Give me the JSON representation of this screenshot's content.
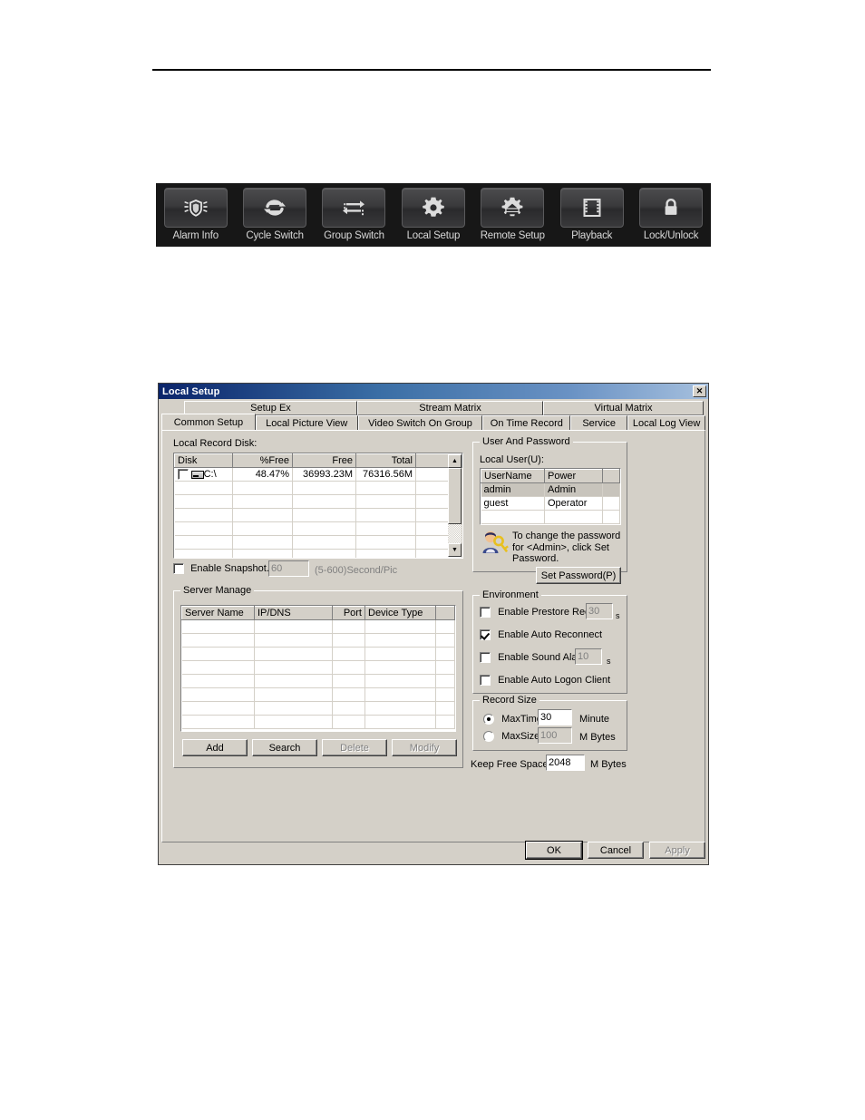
{
  "toolbar": {
    "items": [
      {
        "label": "Alarm Info",
        "icon": "shield-alarm-icon"
      },
      {
        "label": "Cycle Switch",
        "icon": "cycle-arrows-icon"
      },
      {
        "label": "Group Switch",
        "icon": "group-switch-arrows-icon"
      },
      {
        "label": "Local Setup",
        "icon": "gear-icon"
      },
      {
        "label": "Remote Setup",
        "icon": "gear-server-icon"
      },
      {
        "label": "Playback",
        "icon": "film-strip-icon"
      },
      {
        "label": "Lock/Unlock",
        "icon": "padlock-icon"
      }
    ]
  },
  "dialog": {
    "title": "Local Setup",
    "close_label": "✕",
    "tabs_top": [
      "Setup Ex",
      "Stream Matrix",
      "Virtual Matrix"
    ],
    "tabs_bottom": [
      "Common Setup",
      "Local Picture View",
      "Video Switch On Group",
      "On Time Record",
      "Service",
      "Local Log View"
    ],
    "active_tab": "Common Setup",
    "local_record_disk": {
      "label": "Local Record Disk:",
      "columns": [
        "Disk",
        "%Free",
        "Free",
        "Total",
        ""
      ],
      "rows": [
        {
          "disk": "C:\\",
          "pct_free": "48.47%",
          "free": "36993.23M",
          "total": "76316.56M",
          "checked": false
        }
      ],
      "empty_rows": 6
    },
    "snapshot": {
      "label": "Enable Snapshot.",
      "checked": false,
      "value": "60",
      "units": "(5-600)Second/Pic"
    },
    "server_manage": {
      "title": "Server Manage",
      "columns": [
        "Server Name",
        "IP/DNS",
        "Port",
        "Device Type",
        ""
      ],
      "rows": [],
      "empty_rows": 8,
      "buttons": [
        {
          "label": "Add",
          "enabled": true
        },
        {
          "label": "Search",
          "enabled": true
        },
        {
          "label": "Delete",
          "enabled": false
        },
        {
          "label": "Modify",
          "enabled": false
        }
      ]
    },
    "user_and_password": {
      "title": "User And Password",
      "local_user_label": "Local User(U):",
      "columns": [
        "UserName",
        "Power",
        ""
      ],
      "rows": [
        {
          "username": "admin",
          "power": "Admin",
          "selected": true
        },
        {
          "username": "guest",
          "power": "Operator",
          "selected": false
        }
      ],
      "empty_rows": 1,
      "hint": "To change the password for <Admin>, click Set Password.",
      "set_password_label": "Set Password(P)"
    },
    "environment": {
      "title": "Environment",
      "options": [
        {
          "label": "Enable Prestore Record",
          "checked": false,
          "value": "30",
          "unit": "s",
          "has_input": true,
          "input_enabled": false
        },
        {
          "label": "Enable Auto Reconnect",
          "checked": true,
          "value": "",
          "unit": "",
          "has_input": false,
          "input_enabled": false
        },
        {
          "label": "Enable Sound Alarm",
          "checked": false,
          "value": "10",
          "unit": "s",
          "has_input": true,
          "input_enabled": false
        },
        {
          "label": "Enable Auto Logon Client",
          "checked": false,
          "value": "",
          "unit": "",
          "has_input": false,
          "input_enabled": false
        }
      ]
    },
    "record_size": {
      "title": "Record Size",
      "options": [
        {
          "label": "MaxTime",
          "selected": true,
          "value": "30",
          "unit": "Minute",
          "input_enabled": true
        },
        {
          "label": "MaxSize",
          "selected": false,
          "value": "100",
          "unit": "M Bytes",
          "input_enabled": false
        }
      ]
    },
    "keep_free_space": {
      "label": "Keep Free Space",
      "value": "2048",
      "unit": "M Bytes"
    },
    "footer_buttons": [
      {
        "label": "OK",
        "enabled": true,
        "default": true
      },
      {
        "label": "Cancel",
        "enabled": true,
        "default": false
      },
      {
        "label": "Apply",
        "enabled": false,
        "default": false
      }
    ]
  }
}
